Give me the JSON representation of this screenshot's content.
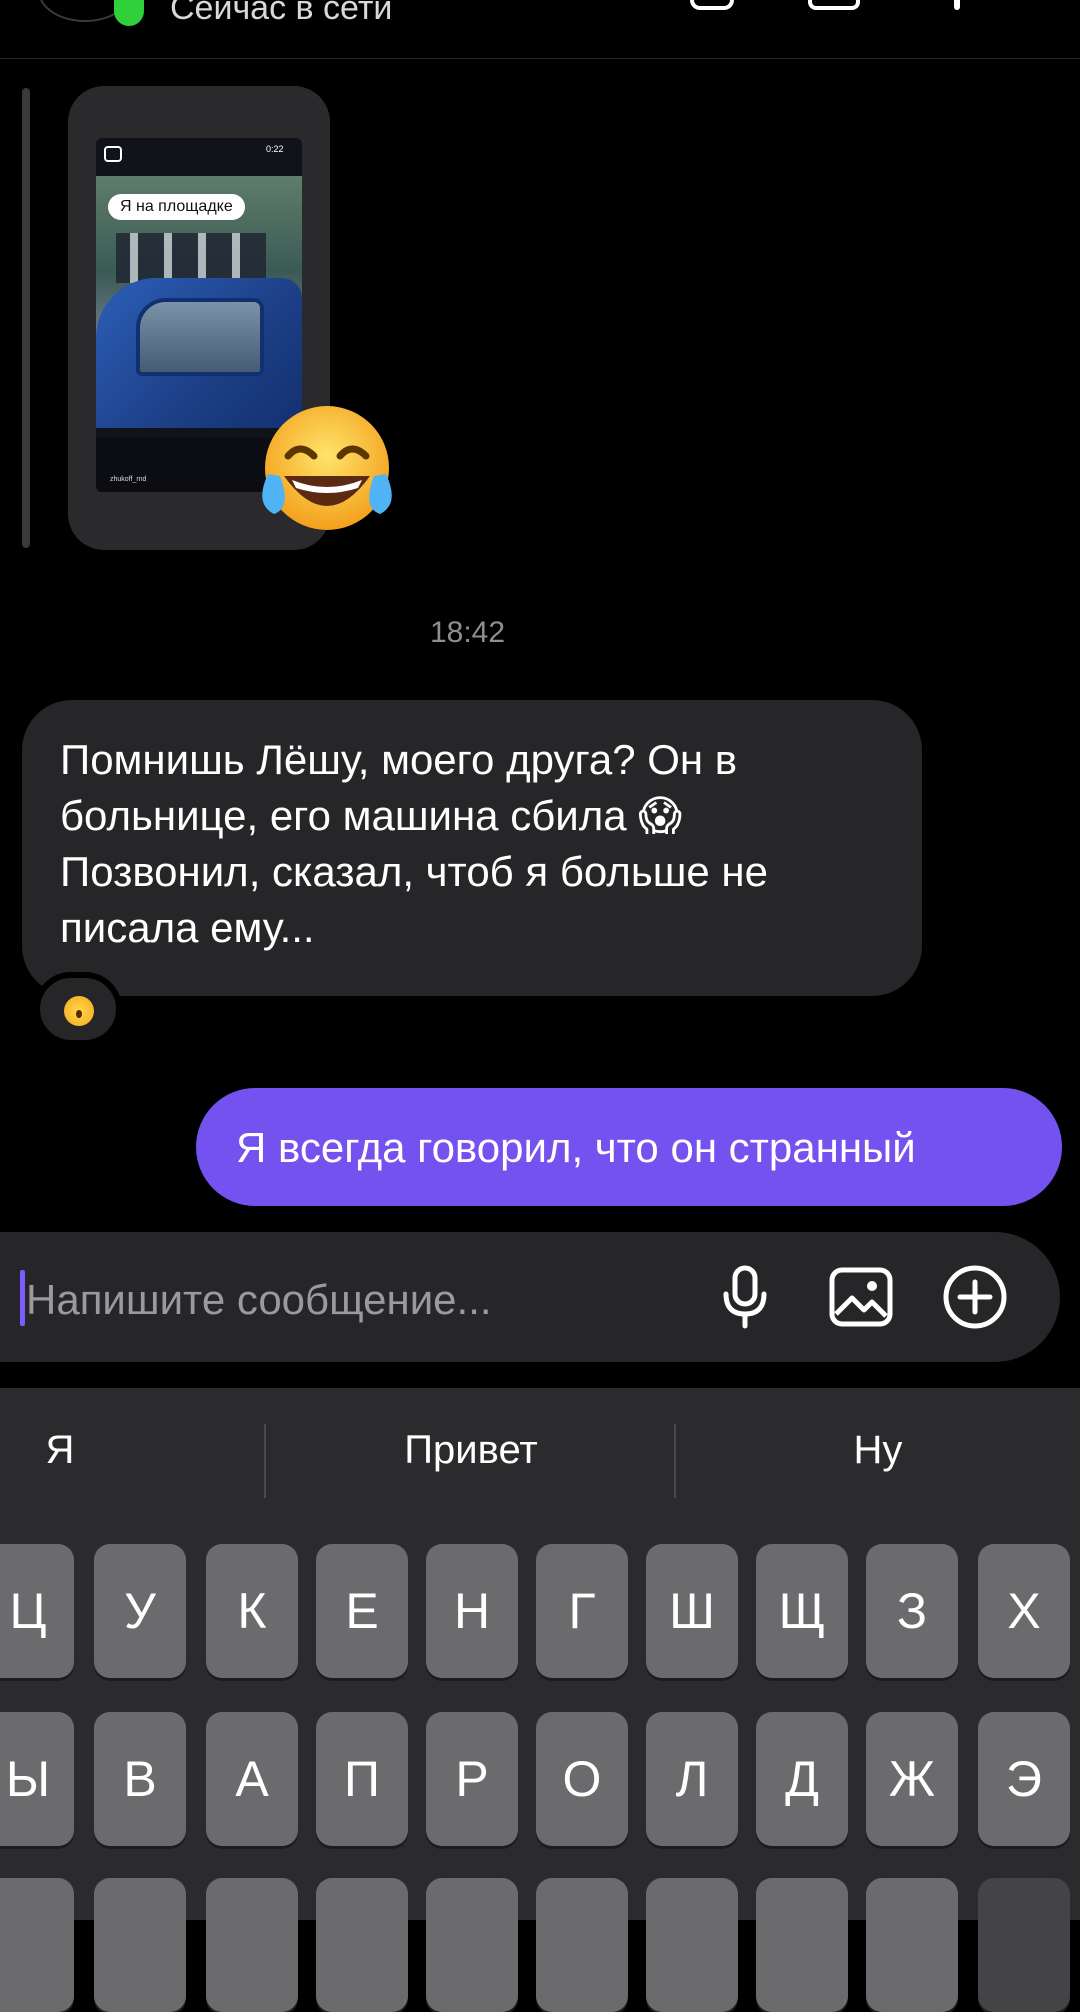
{
  "header": {
    "status_text": "Сейчас в сети",
    "online_color": "#2fd03a"
  },
  "shared_reel": {
    "caption": "Я на площадке",
    "duration": "0:22",
    "author": "zhukoff_rnd",
    "reaction_emoji": "😂"
  },
  "chat": {
    "timestamp": "18:42",
    "incoming_message": "Помнишь Лёшу, моего друга? Он в больнице, его машина сбила 😱 Позвонил, сказал, чтоб я больше не писала ему...",
    "incoming_reaction": "😮",
    "outgoing_message": "Я всегда говорил, что он странный",
    "outgoing_color": "#7452f0"
  },
  "composer": {
    "placeholder": "Напишите сообщение...",
    "icons": [
      "microphone-icon",
      "image-icon",
      "plus-circle-icon"
    ]
  },
  "keyboard": {
    "suggestions": [
      "Я",
      "Привет",
      "Ну"
    ],
    "row1": [
      "Ц",
      "У",
      "К",
      "Е",
      "Н",
      "Г",
      "Ш",
      "Щ",
      "З",
      "Х"
    ],
    "row2": [
      "Ы",
      "В",
      "А",
      "П",
      "Р",
      "О",
      "Л",
      "Д",
      "Ж",
      "Э"
    ]
  }
}
